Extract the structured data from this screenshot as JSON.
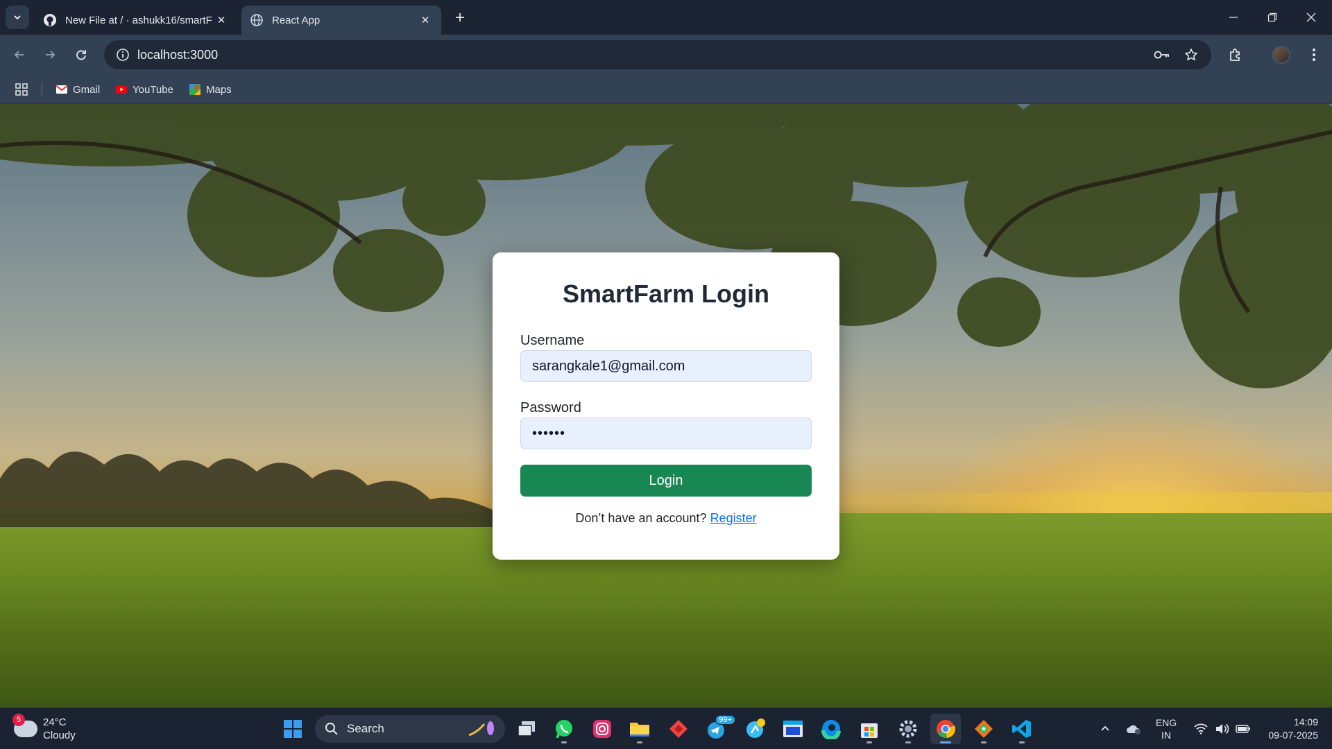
{
  "browser": {
    "tabs": [
      {
        "title": "New File at / · ashukk16/smartF",
        "favicon": "github-icon",
        "active": false
      },
      {
        "title": "React App",
        "favicon": "globe-icon",
        "active": true
      }
    ],
    "url": "localhost:3000",
    "bookmarks": [
      {
        "label": "Gmail",
        "icon": "gmail-icon"
      },
      {
        "label": "YouTube",
        "icon": "youtube-icon"
      },
      {
        "label": "Maps",
        "icon": "maps-icon"
      }
    ]
  },
  "login": {
    "title": "SmartFarm Login",
    "username_label": "Username",
    "username_value": "sarangkale1@gmail.com",
    "password_label": "Password",
    "password_value": "••••••",
    "submit_label": "Login",
    "register_prompt": "Don’t have an account?",
    "register_link": "Register"
  },
  "taskbar": {
    "weather": {
      "temp": "24°C",
      "condition": "Cloudy",
      "badge": "5"
    },
    "search_label": "Search",
    "telegram_badge": "99+",
    "language": {
      "top": "ENG",
      "bottom": "IN"
    },
    "time": "14:09",
    "date": "09-07-2025"
  },
  "colors": {
    "login_button": "#198754",
    "link": "#0d6efd",
    "input_autofill": "#e8f0fe",
    "chrome_dark": "#1c2433",
    "chrome_toolbar": "#334155"
  }
}
